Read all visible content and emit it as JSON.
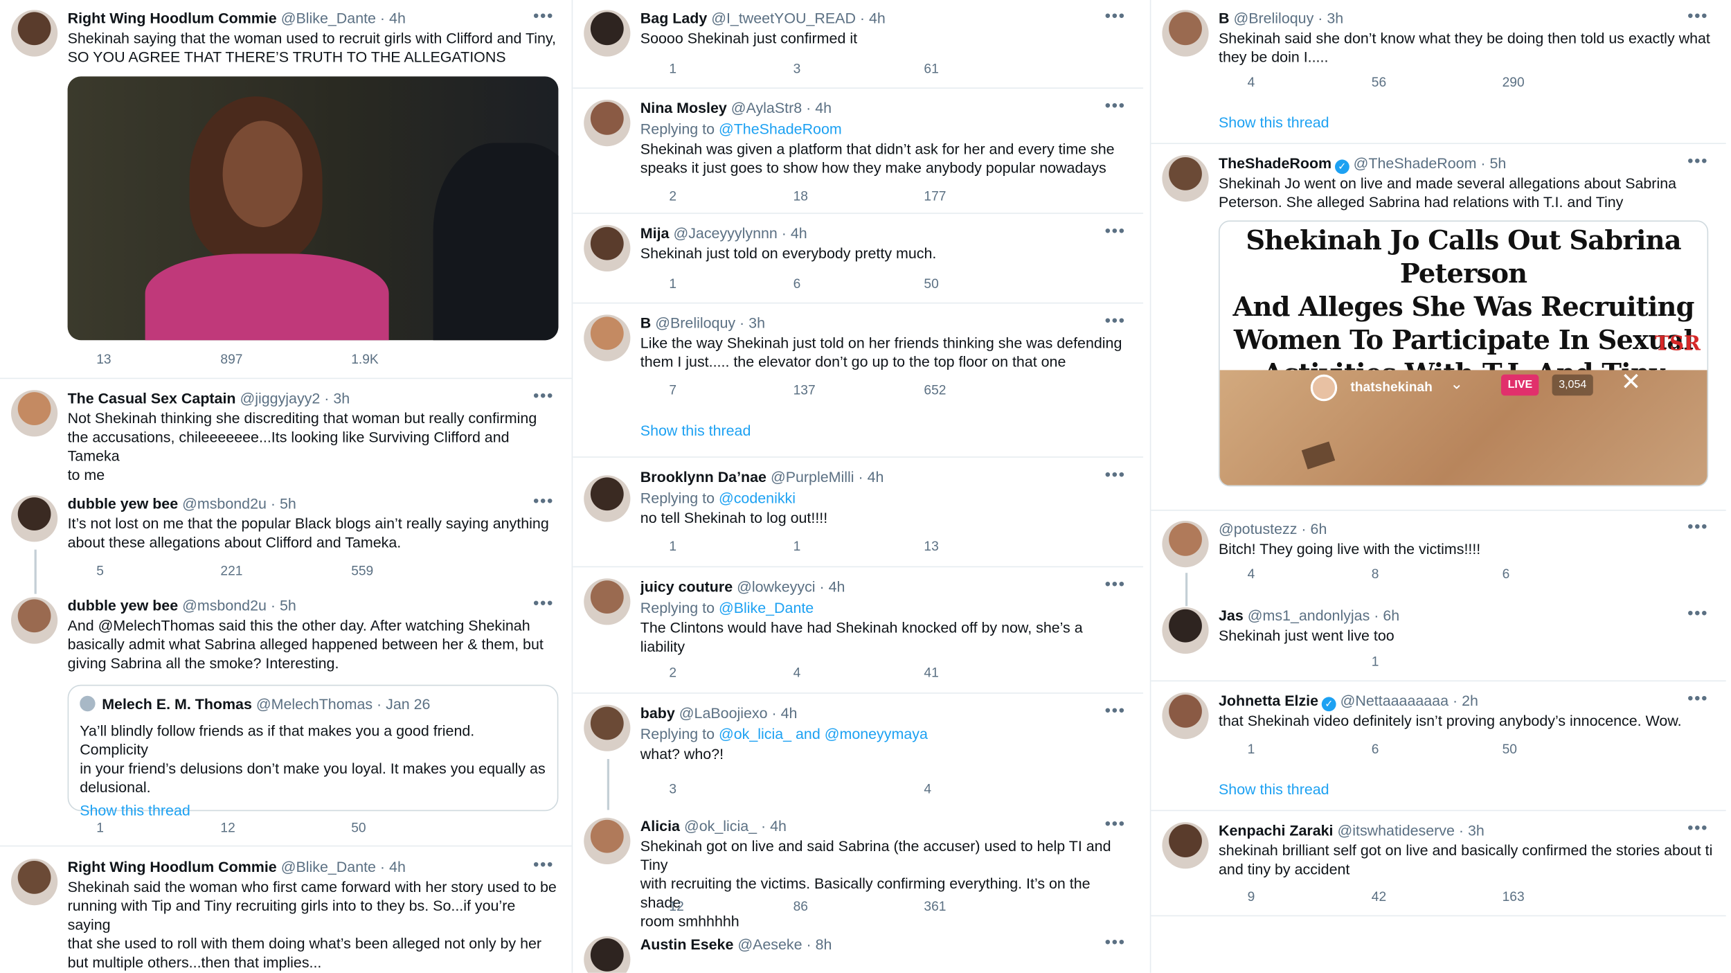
{
  "accent": "#1da1f2",
  "columns": {
    "left": {
      "tweets": [
        {
          "name": "Right Wing Hoodlum Commie",
          "handle": "@Blike_Dante",
          "time": "4h",
          "lines": [
            "Shekinah saying that the woman used to recruit girls with Clifford and Tiny,",
            "SO YOU AGREE THAT THERE’S TRUTH TO THE ALLEGATIONS"
          ],
          "replies": "13",
          "retweets": "897",
          "likes": "1.9K"
        },
        {
          "name": "The Casual Sex Captain",
          "handle": "@jiggyjayy2",
          "time": "3h",
          "lines": [
            "Not Shekinah thinking she discrediting that woman but really confirming",
            "the accusations, chileeeeeee...Its looking like Surviving Clifford and Tameka",
            "to me"
          ]
        },
        {
          "name": "dubble yew bee",
          "handle": "@msbond2u",
          "time": "5h",
          "lines": [
            "It’s not lost on me that the popular Black blogs ain’t really saying anything",
            "about these allegations about Clifford and Tameka."
          ],
          "replies": "5",
          "retweets": "221",
          "likes": "559"
        },
        {
          "name": "dubble yew bee",
          "handle": "@msbond2u",
          "time": "5h",
          "lines": [
            "And @MelechThomas said this the other day. After watching Shekinah",
            "basically admit what Sabrina alleged happened between her & them, but",
            "giving Sabrina all the smoke? Interesting."
          ],
          "quote": {
            "name": "Melech E. M. Thomas",
            "handle": "@MelechThomas",
            "time": "Jan 26",
            "lines": [
              "Ya’ll blindly follow friends as if that makes you a good friend. Complicity",
              "in your friend’s delusions don’t make you loyal. It makes you equally as",
              "delusional."
            ],
            "thread": "Show this thread"
          },
          "replies": "1",
          "retweets": "12",
          "likes": "50"
        },
        {
          "name": "Right Wing Hoodlum Commie",
          "handle": "@Blike_Dante",
          "time": "4h",
          "lines": [
            "Shekinah said the woman who first came forward with her story used to be",
            "running with Tip and Tiny recruiting girls into to they bs. So...if you’re saying",
            "that she used to roll with them doing what’s been alleged not only by her",
            "but multiple others...then that implies..."
          ]
        }
      ]
    },
    "middle": {
      "tweets": [
        {
          "name": "Bag Lady",
          "handle": "@I_tweetYOU_READ",
          "time": "4h",
          "lines": [
            "Soooo Shekinah just confirmed it"
          ],
          "replies": "1",
          "retweets": "3",
          "likes": "61"
        },
        {
          "name": "Nina Mosley",
          "handle": "@AylaStr8",
          "time": "4h",
          "replying": "@TheShadeRoom",
          "lines": [
            "Shekinah was given a platform that didn’t ask for her and every time she",
            "speaks it just goes to show how they make anybody popular nowadays"
          ],
          "replies": "2",
          "retweets": "18",
          "likes": "177"
        },
        {
          "name": "Mija",
          "handle": "@Jaceyyylynnn",
          "time": "4h",
          "lines": [
            "Shekinah just told on everybody pretty much."
          ],
          "replies": "1",
          "retweets": "6",
          "likes": "50"
        },
        {
          "name": "B",
          "handle": "@Breliloquy",
          "time": "3h",
          "lines": [
            "Like the way Shekinah just told on her friends thinking she was defending",
            "them I just..... the elevator don’t go up to the top floor on that one"
          ],
          "replies": "7",
          "retweets": "137",
          "likes": "652",
          "thread": "Show this thread"
        },
        {
          "name": "Brooklynn Da’nae",
          "handle": "@PurpleMilli",
          "time": "4h",
          "replying": "@codenikki",
          "lines": [
            "no tell Shekinah to log out!!!!"
          ],
          "replies": "1",
          "retweets": "1",
          "likes": "13"
        },
        {
          "name": "juicy couture",
          "handle": "@lowkeyyci",
          "time": "4h",
          "replying": "@Blike_Dante",
          "lines": [
            "The Clintons would have had Shekinah knocked off by now, she’s a liability"
          ],
          "replies": "2",
          "retweets": "4",
          "likes": "41"
        },
        {
          "name": "baby",
          "handle": "@LaBoojiexo",
          "time": "4h",
          "replying": "@ok_licia_ and @moneyymaya",
          "lines": [
            "what? who?!"
          ],
          "replies": "3",
          "retweets": "",
          "likes": "4"
        },
        {
          "name": "Alicia",
          "handle": "@ok_licia_",
          "time": "4h",
          "lines": [
            "Shekinah got on live and said Sabrina (the accuser) used to help TI and Tiny",
            "with recruiting the victims. Basically confirming everything. It’s on the shade",
            "room smhhhhh"
          ],
          "replies": "12",
          "retweets": "86",
          "likes": "361"
        },
        {
          "name": "Austin Eseke",
          "handle": "@Aeseke",
          "time": "8h",
          "lines": []
        }
      ]
    },
    "right": {
      "tweets": [
        {
          "name": "B",
          "handle": "@Breliloquy",
          "time": "3h",
          "lines": [
            "Shekinah said she don’t know what they be doing then told us exactly what",
            "they be doin I....."
          ],
          "replies": "4",
          "retweets": "56",
          "likes": "290",
          "thread": "Show this thread"
        },
        {
          "name": "TheShadeRoom",
          "handle": "@TheShadeRoom",
          "time": "5h",
          "lines": [
            "Shekinah Jo went on live and made several allegations about Sabrina",
            "Peterson. She alleged Sabrina had relations with T.I. and Tiny"
          ],
          "media": {
            "headline": [
              "Shekinah Jo Calls Out Sabrina Peterson",
              "And Alleges She Was Recruiting",
              "Women To Participate In Sexual",
              "Activities With T.I. And Tiny"
            ],
            "logo": "TSR",
            "live_user": "thatshekinah",
            "live": "LIVE",
            "viewers": "3,054"
          }
        },
        {
          "name": "",
          "handle": "@potustezz",
          "time": "6h",
          "lines": [
            "Bitch! They going live with the victims!!!!"
          ],
          "replies": "4",
          "retweets": "8",
          "likes": "6"
        },
        {
          "name": "Jas",
          "handle": "@ms1_andonlyjas",
          "time": "6h",
          "lines": [
            "Shekinah just went live too"
          ],
          "replies": "",
          "retweets": "1",
          "likes": ""
        },
        {
          "name": "Johnetta Elzie",
          "handle": "@Nettaaaaaaaa",
          "time": "2h",
          "lines": [
            "that Shekinah video definitely isn’t proving anybody’s innocence. Wow."
          ],
          "replies": "1",
          "retweets": "6",
          "likes": "50",
          "thread": "Show this thread"
        },
        {
          "name": "Kenpachi Zaraki",
          "handle": "@itswhatideserve",
          "time": "3h",
          "lines": [
            "shekinah brilliant self got on live and basically confirmed the stories about ti",
            "and tiny by accident"
          ],
          "replies": "9",
          "retweets": "42",
          "likes": "163"
        }
      ]
    }
  }
}
